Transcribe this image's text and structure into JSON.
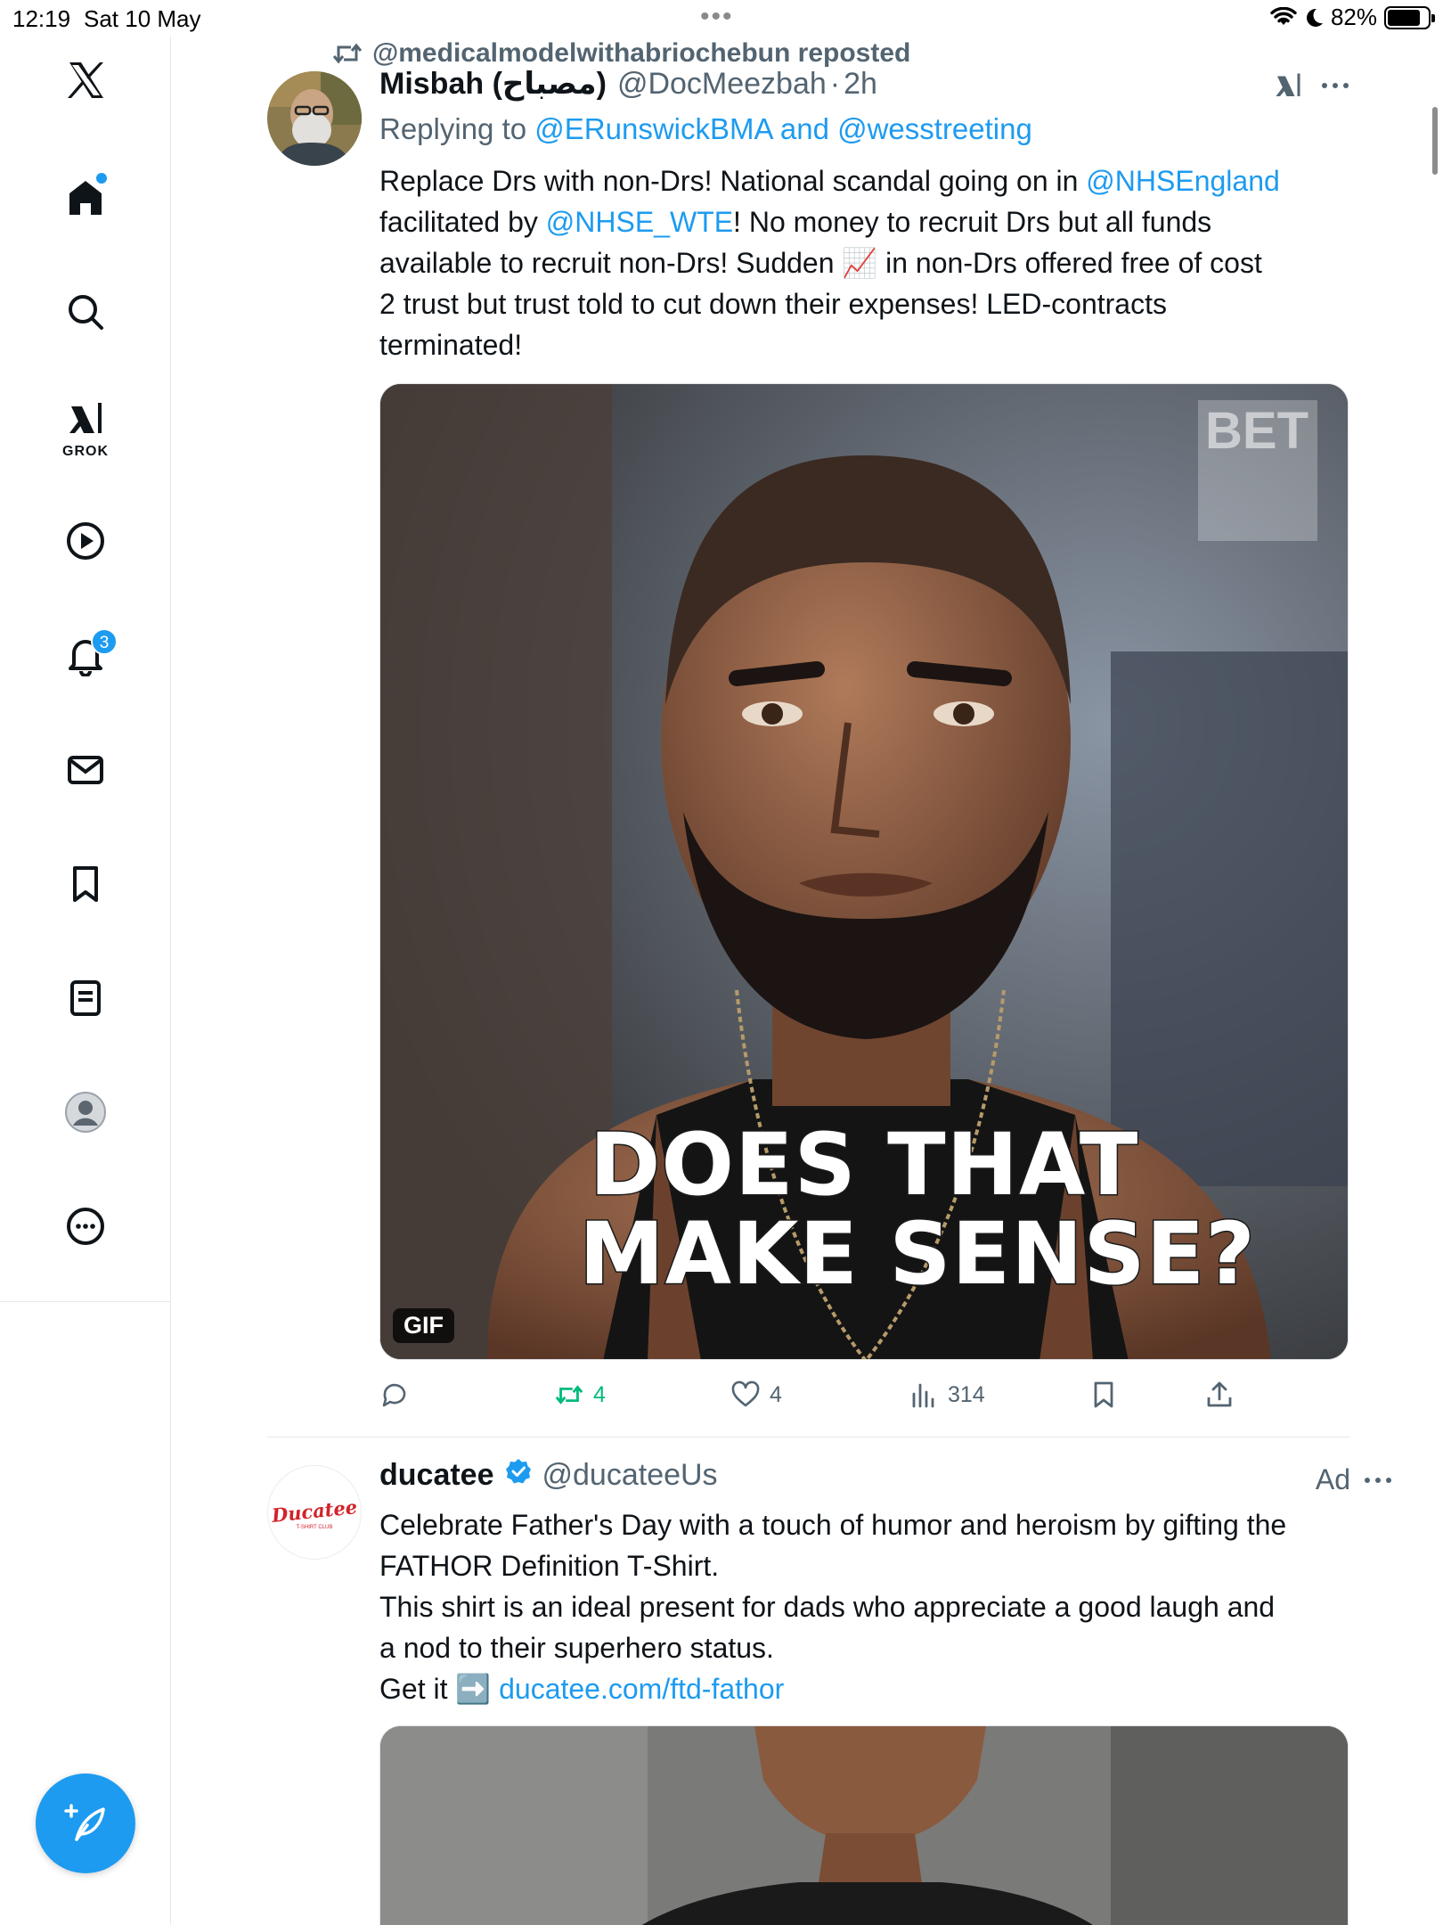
{
  "status_bar": {
    "time": "12:19",
    "date": "Sat 10 May",
    "battery": "82%",
    "battery_fraction": 0.82
  },
  "sidebar": {
    "items": [
      {
        "name": "X"
      },
      {
        "name": "Home"
      },
      {
        "name": "Search"
      },
      {
        "name": "Grok",
        "label": "GROK"
      },
      {
        "name": "Videos"
      },
      {
        "name": "Notifications",
        "badge": "3"
      },
      {
        "name": "Messages"
      },
      {
        "name": "Bookmarks"
      },
      {
        "name": "Lists"
      },
      {
        "name": "Profile"
      },
      {
        "name": "More"
      }
    ]
  },
  "tweet1": {
    "repost_by": "@medicalmodelwithabriochebun reposted",
    "author_name": "Misbah (مصباح)",
    "handle": "@DocMeezbah",
    "time_sep": "·",
    "time": "2h",
    "replying_prefix": "Replying to",
    "reply_user1": "@ERunswickBMA",
    "reply_and": "and",
    "reply_user2": "@wesstreeting",
    "text": {
      "p1": "Replace Drs with non-Drs! National scandal going on in ",
      "m1": "@NHSEngland",
      "p2": "facilitated by ",
      "m2": "@NHSE_WTE",
      "p3": "! No money to recruit Drs but all funds",
      "p4": "available to recruit non-Drs! Sudden ",
      "emoji": "📈",
      "p5": " in non-Drs offered free of cost",
      "p6": "2 trust but trust told to cut down their expenses! LED-contracts",
      "p7": "terminated!"
    },
    "media": {
      "caption_line1": "DOES THAT",
      "caption_line2": "MAKE SENSE?",
      "gif_badge": "GIF",
      "watermark": "BET"
    },
    "actions": {
      "replies": "",
      "reposts": "4",
      "likes": "4",
      "views": "314"
    }
  },
  "tweet2": {
    "author_name": "ducatee",
    "handle": "@ducateeUs",
    "ad_label": "Ad",
    "avatar_text": "Ducatee",
    "avatar_subtext": "T-SHIRT CLUB",
    "text": {
      "l1": "Celebrate Father's Day with a touch of humor and heroism by gifting the",
      "l2": "FATHOR Definition T-Shirt.",
      "l3": "This shirt is an ideal present for dads who appreciate a good laugh and",
      "l4": "a nod to their superhero status.",
      "l5_prefix": "Get it ",
      "l5_emoji": "➡️",
      "link": "ducatee.com/ftd-fathor"
    }
  },
  "colors": {
    "accent": "#1d9bf0",
    "repost_green": "#00ba7c",
    "muted": "#536471"
  }
}
